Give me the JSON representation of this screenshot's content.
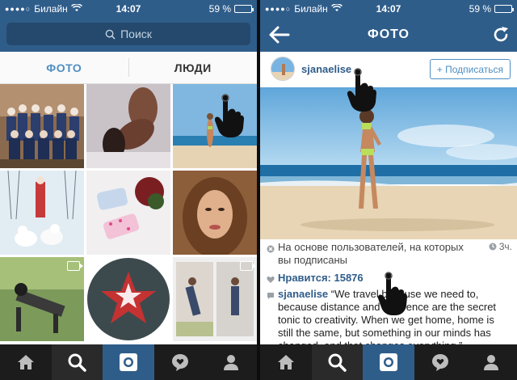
{
  "status_bar": {
    "signal": "●●●●○",
    "carrier": "Билайн",
    "time": "14:07",
    "battery_percent": "59 %",
    "battery_level": 0.59
  },
  "left": {
    "search_placeholder": "Поиск",
    "segments": {
      "photos": "ФОТО",
      "people": "ЛЮДИ",
      "active": "photos"
    }
  },
  "right": {
    "nav_title": "ФОТО",
    "post": {
      "username": "sjanaelise",
      "follow_label": "+ Подписаться",
      "suggestion_text": "На основе пользователей, на которых вы подписаны",
      "time_ago": "3ч.",
      "likes_label": "Нравится: 15876",
      "caption_user": "sjanaelise",
      "caption_text": "“We travel because we need to, because distance and difference are the secret tonic to creativity. When we get home, home is still the same, but something in our minds has changed, and that changes everything.”"
    }
  },
  "tab_bar": [
    "home-icon",
    "search-icon",
    "camera-icon",
    "activity-icon",
    "profile-icon"
  ],
  "colors": {
    "nav_blue": "#2f5d8a",
    "accent_blue": "#4e8ec2",
    "tab_bar": "#1c1c1c"
  }
}
